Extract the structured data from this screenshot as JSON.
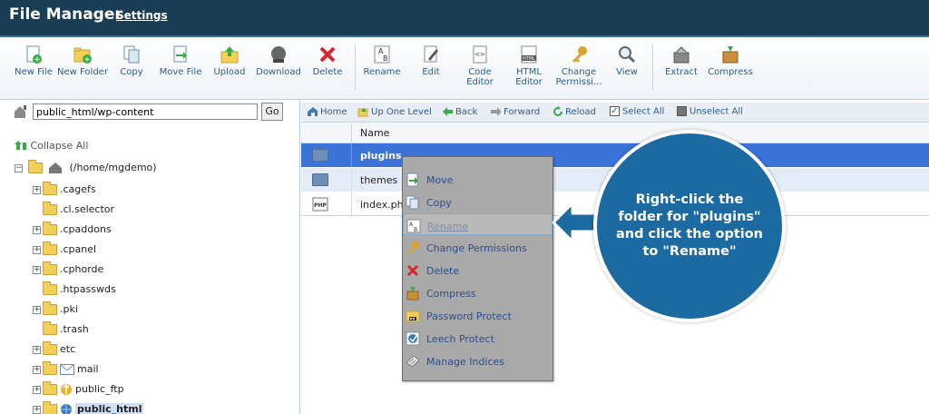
{
  "header": {
    "title": "File Manager",
    "settings": "Settings"
  },
  "toolbar": {
    "new_file": "New File",
    "new_folder": "New Folder",
    "copy": "Copy",
    "move_file": "Move File",
    "upload": "Upload",
    "download": "Download",
    "delete": "Delete",
    "rename": "Rename",
    "edit": "Edit",
    "code_editor": "Code Editor",
    "html_editor": "HTML Editor",
    "change_permissions": "Change Permissi...",
    "view": "View",
    "extract": "Extract",
    "compress": "Compress"
  },
  "path": {
    "value": "public_html/wp-content",
    "go": "Go"
  },
  "tree": {
    "collapse_all": "Collapse All",
    "root": "(/home/mgdemo)",
    "items": [
      {
        "label": ".cagefs",
        "expandable": true
      },
      {
        "label": ".cl.selector",
        "expandable": false
      },
      {
        "label": ".cpaddons",
        "expandable": true
      },
      {
        "label": ".cpanel",
        "expandable": true
      },
      {
        "label": ".cphorde",
        "expandable": true
      },
      {
        "label": ".htpasswds",
        "expandable": false
      },
      {
        "label": ".pki",
        "expandable": true
      },
      {
        "label": ".trash",
        "expandable": false
      },
      {
        "label": "etc",
        "expandable": true
      },
      {
        "label": "mail",
        "expandable": true
      },
      {
        "label": "public_ftp",
        "expandable": true
      },
      {
        "label": "public_html",
        "expandable": true
      }
    ]
  },
  "nav": {
    "home": "Home",
    "up_one_level": "Up One Level",
    "back": "Back",
    "forward": "Forward",
    "reload": "Reload",
    "select_all": "Select All",
    "unselect_all": "Unselect All"
  },
  "list": {
    "header_name": "Name",
    "rows": [
      "plugins",
      "themes",
      "index.php"
    ]
  },
  "context_menu": {
    "move": "Move",
    "copy": "Copy",
    "rename": "Rename",
    "change_permissions": "Change Permissions",
    "delete": "Delete",
    "compress": "Compress",
    "password_protect": "Password Protect",
    "leech_protect": "Leech Protect",
    "manage_indices": "Manage Indices"
  },
  "callout": {
    "text": "Right-click the\nfolder for \"plugins\"\nand click the option\nto \"Rename\""
  },
  "colors": {
    "header": "#193d54",
    "selected_row": "#3b73d9",
    "callout": "#1c6aa2"
  }
}
